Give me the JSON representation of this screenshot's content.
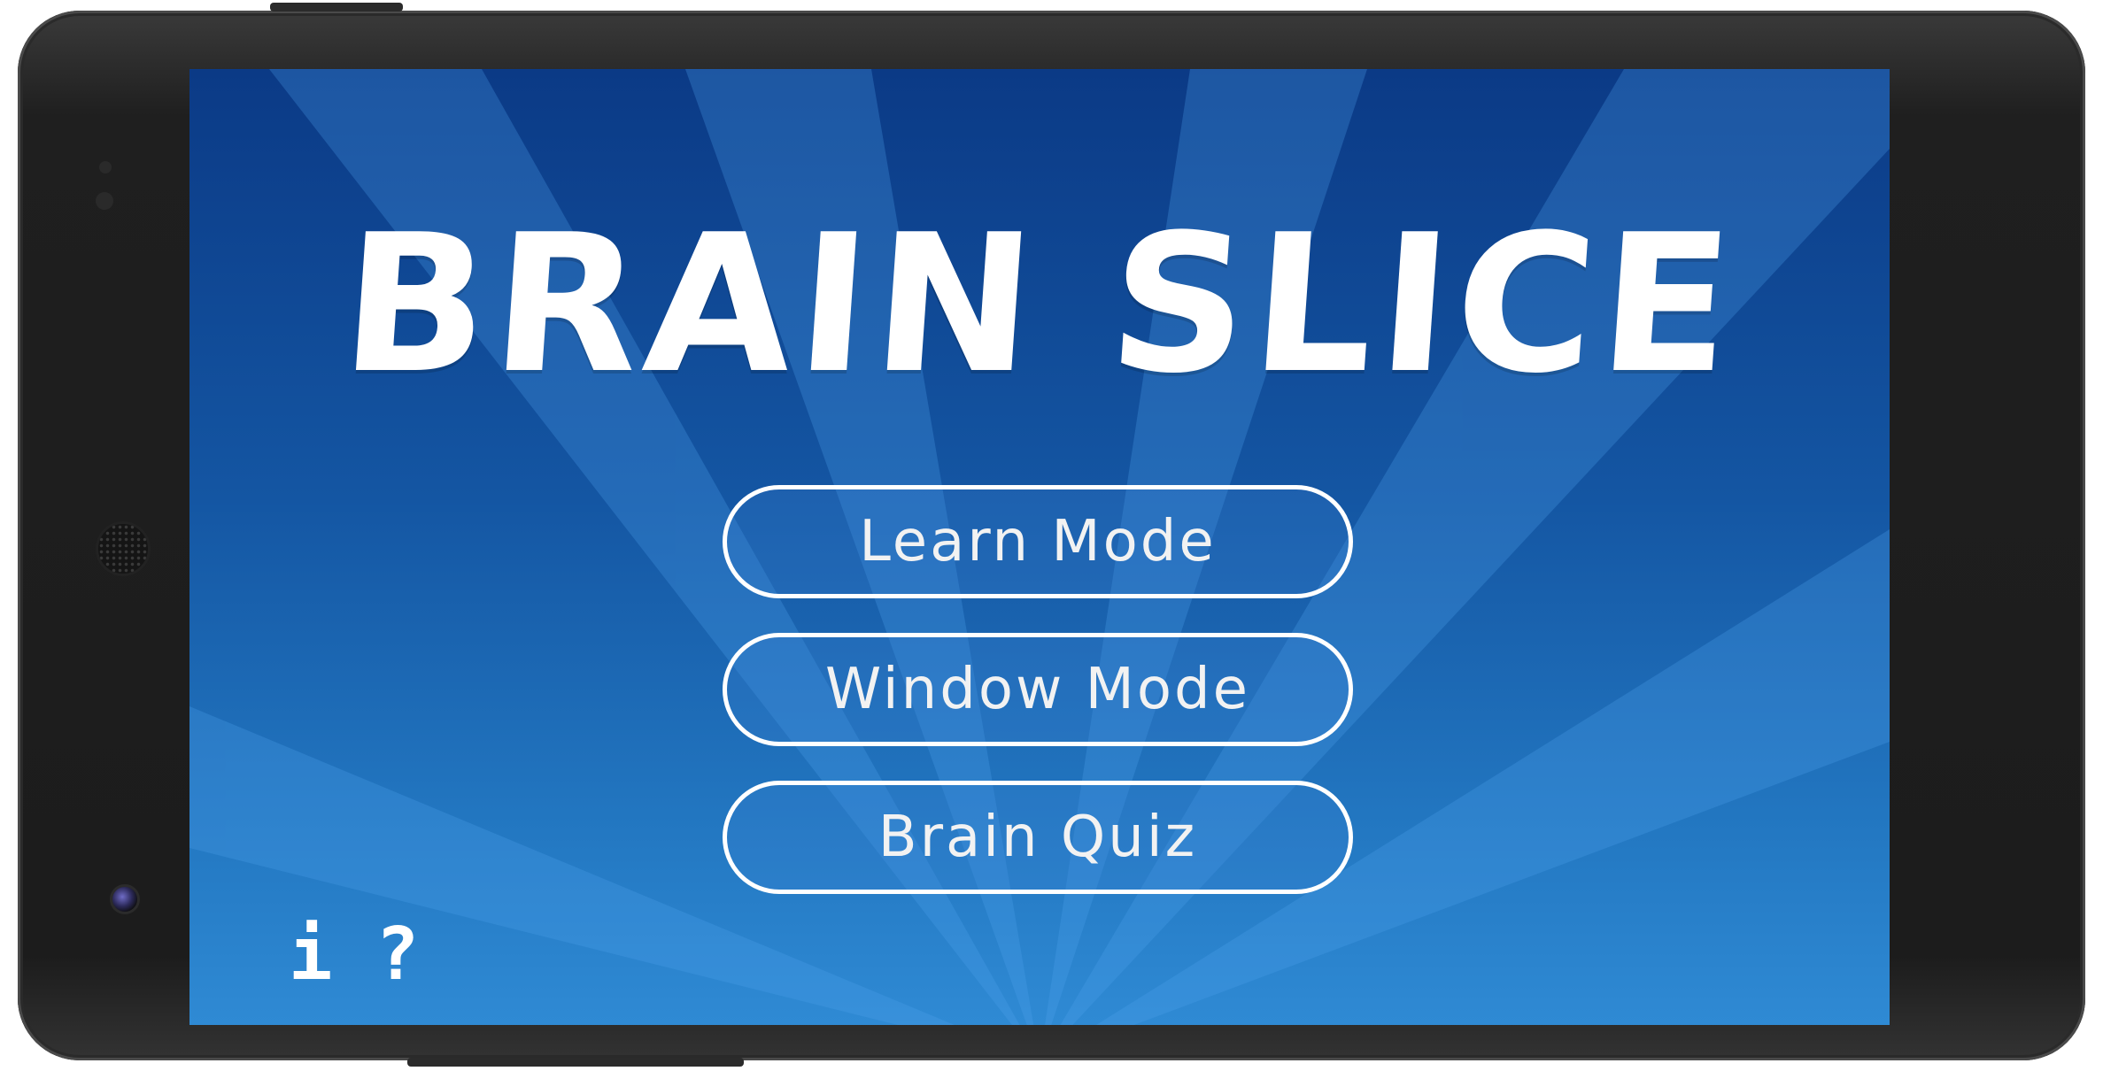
{
  "app": {
    "title": "BRAIN SLICE"
  },
  "menu": {
    "learn_mode": "Learn Mode",
    "window_mode": "Window Mode",
    "brain_quiz": "Brain Quiz"
  },
  "footer": {
    "info_glyph": "i",
    "help_glyph": "?",
    "info_icon": "info-icon",
    "help_icon": "help-icon"
  },
  "colors": {
    "background_top": "#0b3a86",
    "background_bottom": "#2f8ad4",
    "text": "#ffffff"
  }
}
